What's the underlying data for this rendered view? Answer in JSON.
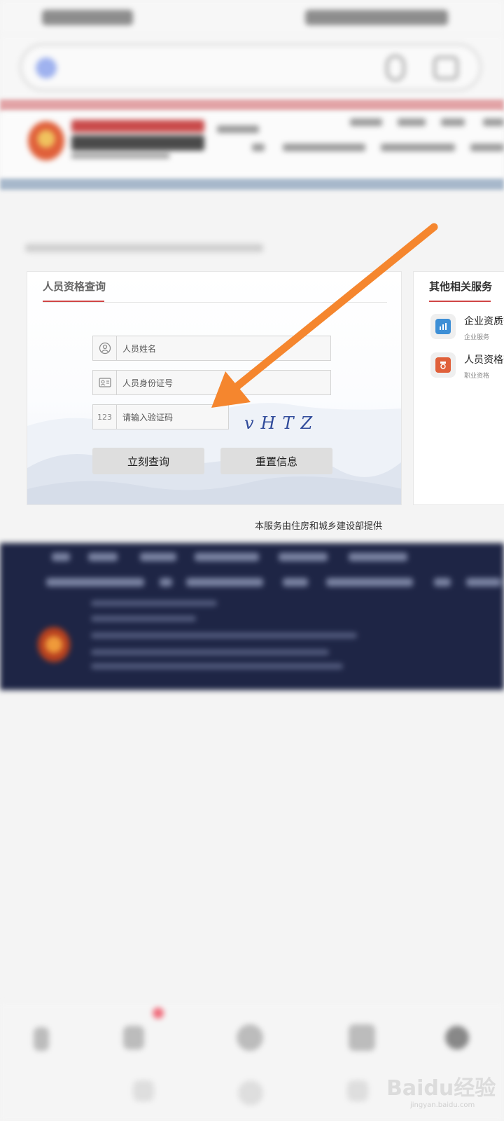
{
  "query_card": {
    "title": "人员资格查询",
    "name_placeholder": "人员姓名",
    "id_placeholder": "人员身份证号",
    "captcha_placeholder": "请输入验证码",
    "captcha_text": "vHTZ",
    "query_button": "立刻查询",
    "reset_button": "重置信息",
    "id_icon_text": "123"
  },
  "side_card": {
    "title": "其他相关服务",
    "services": [
      {
        "name": "企业资质查",
        "tag": "企业服务",
        "color": "#3d8fd6"
      },
      {
        "name": "人员资格查",
        "tag": "职业资格",
        "color": "#e0603a"
      }
    ]
  },
  "provider_note": "本服务由住房和城乡建设部提供",
  "watermark": {
    "brand": "Baidu经验",
    "url": "jingyan.baidu.com"
  },
  "colors": {
    "accent_red": "#d04646",
    "footer_bg": "#1e2545",
    "arrow": "#f5862e"
  }
}
